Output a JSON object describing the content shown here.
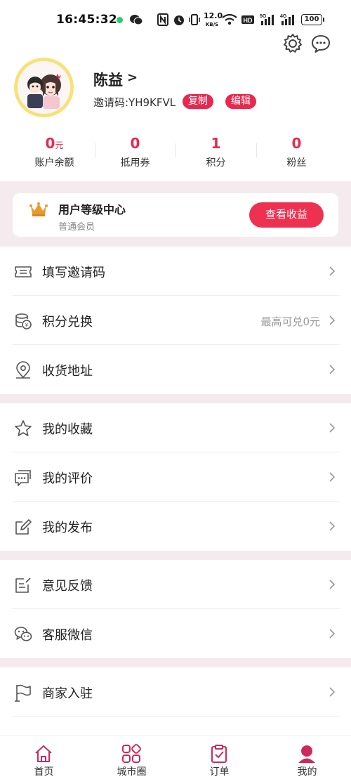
{
  "status_bar": {
    "time": "16:45:32",
    "net_speed_top": "12.0",
    "net_speed_unit": "KB/S",
    "battery": "100"
  },
  "header": {
    "settings_icon": "gear-icon",
    "message_icon": "chat-bubble-icon"
  },
  "profile": {
    "name": "陈益",
    "arrow": ">",
    "invite_code_text": "邀请码:YH9KFVL",
    "copy_label": "复制",
    "edit_label": "编辑"
  },
  "stats": [
    {
      "value": "0",
      "unit": "元",
      "label": "账户余额"
    },
    {
      "value": "0",
      "unit": "",
      "label": "抵用券"
    },
    {
      "value": "1",
      "unit": "",
      "label": "积分"
    },
    {
      "value": "0",
      "unit": "",
      "label": "粉丝"
    }
  ],
  "level": {
    "title": "用户等级中心",
    "subtitle": "普通会员",
    "button": "查看收益"
  },
  "menu": {
    "invite": {
      "label": "填写邀请码",
      "right": ""
    },
    "points": {
      "label": "积分兑换",
      "right": "最高可兑0元"
    },
    "address": {
      "label": "收货地址",
      "right": ""
    },
    "favorites": {
      "label": "我的收藏",
      "right": ""
    },
    "reviews": {
      "label": "我的评价",
      "right": ""
    },
    "posts": {
      "label": "我的发布",
      "right": ""
    },
    "feedback": {
      "label": "意见反馈",
      "right": ""
    },
    "wechat": {
      "label": "客服微信",
      "right": ""
    },
    "merchant": {
      "label": "商家入驻",
      "right": ""
    }
  },
  "tabs": [
    {
      "label": "首页",
      "icon": "home-icon"
    },
    {
      "label": "城市圈",
      "icon": "grid-icon"
    },
    {
      "label": "订单",
      "icon": "clipboard-icon"
    },
    {
      "label": "我的",
      "icon": "person-icon"
    }
  ],
  "colors": {
    "accent": "#e8294f",
    "band": "#f5eaee",
    "avatar_ring": "#f7e27a"
  }
}
